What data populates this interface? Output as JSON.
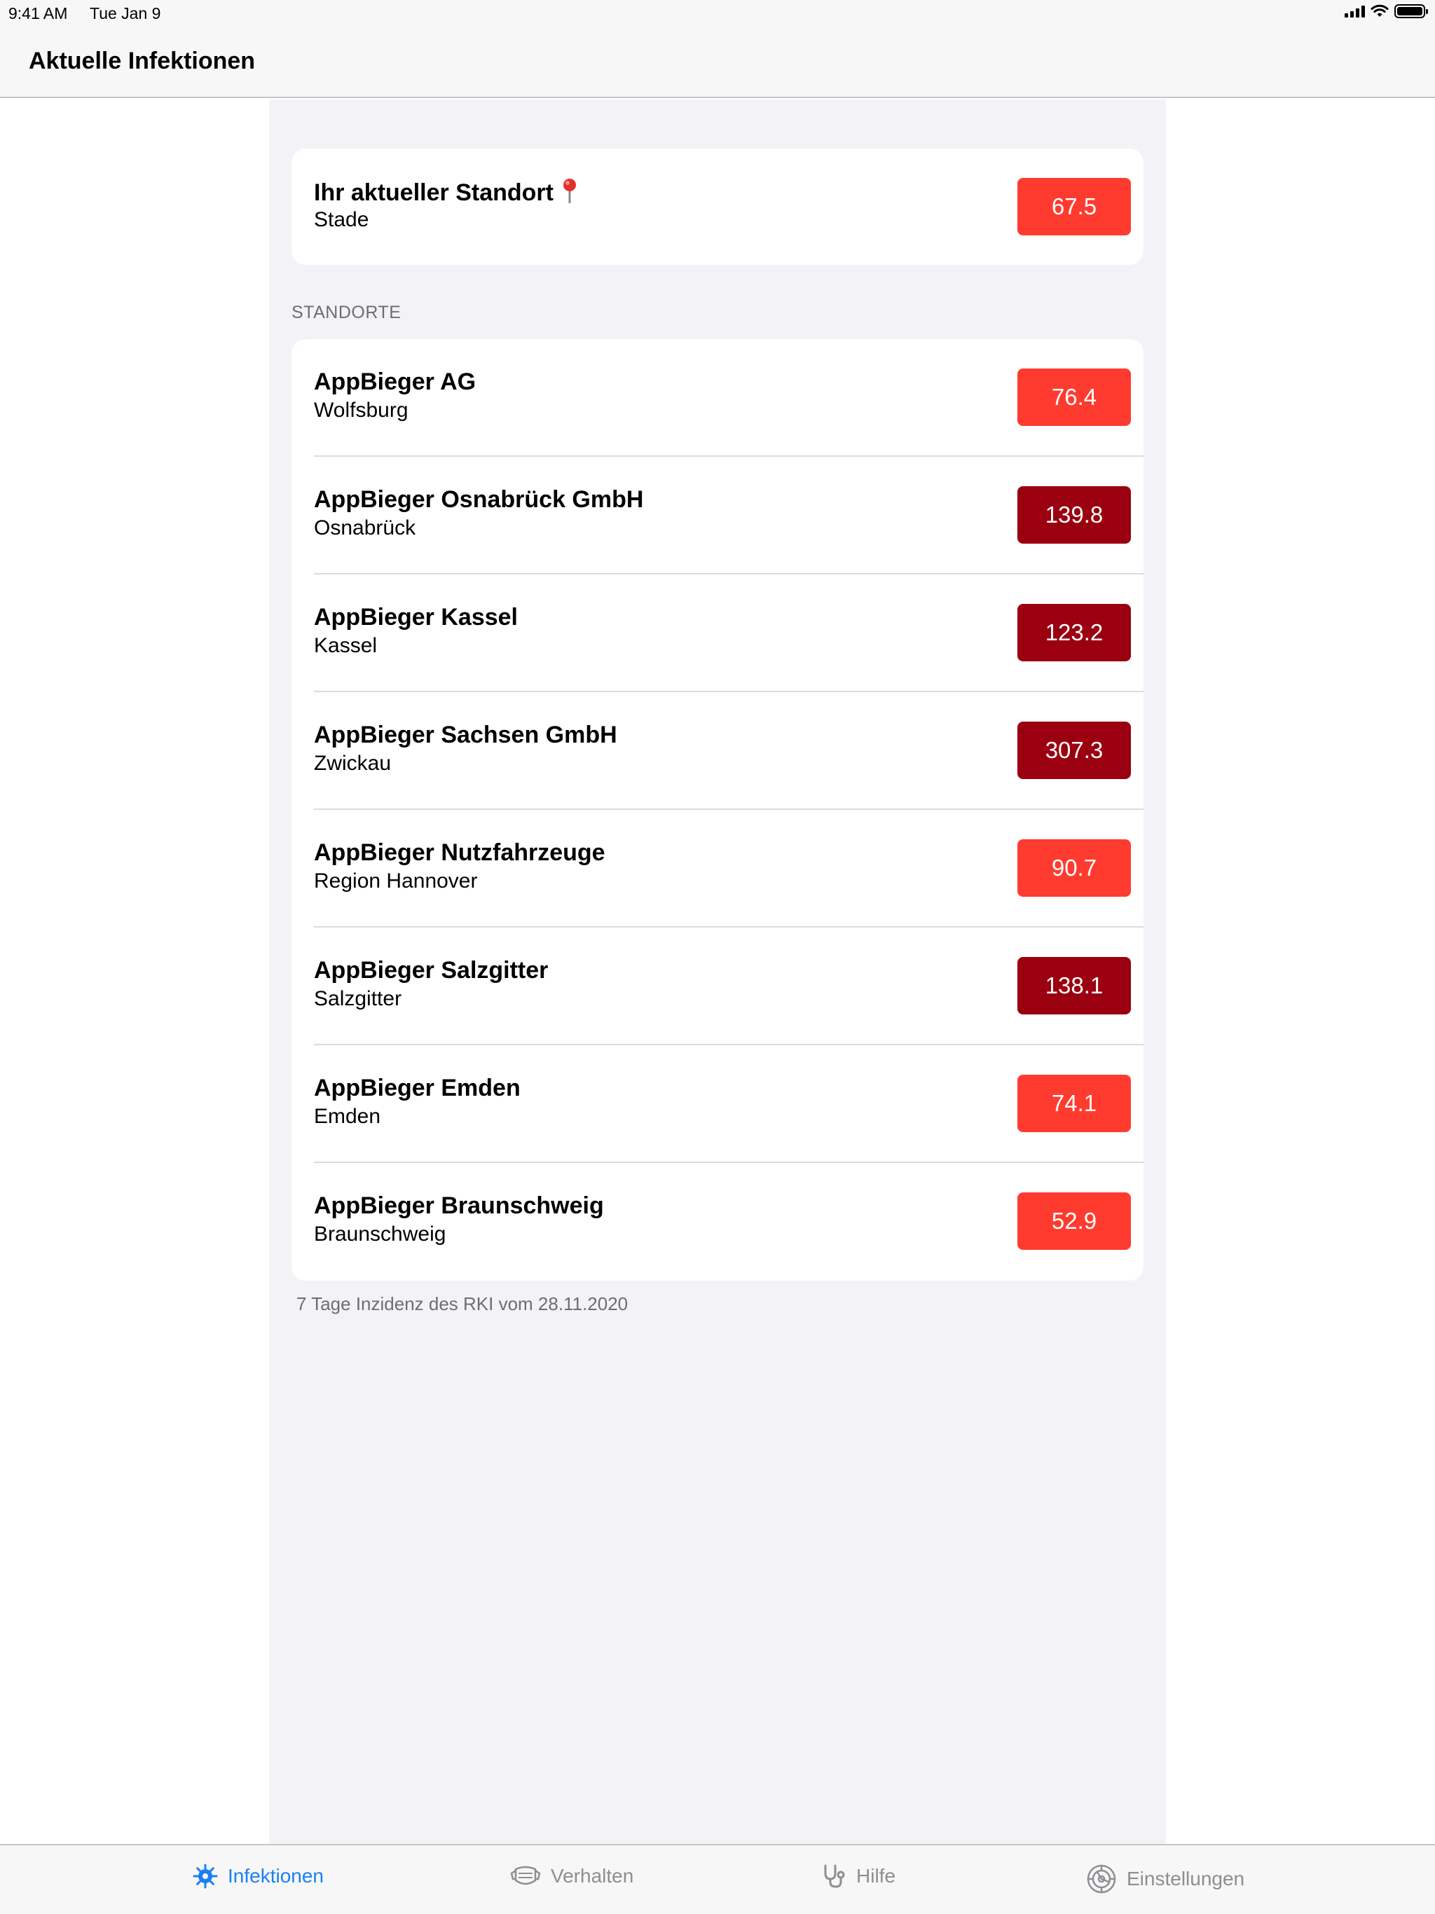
{
  "status_bar": {
    "time": "9:41 AM",
    "date": "Tue Jan 9"
  },
  "nav": {
    "title": "Aktuelle Infektionen"
  },
  "current_location": {
    "title": "Ihr aktueller Standort",
    "city": "Stade",
    "value": "67.5",
    "level": "high"
  },
  "section_header": "STANDORTE",
  "locations": [
    {
      "name": "AppBieger AG",
      "city": "Wolfsburg",
      "value": "76.4",
      "level": "high"
    },
    {
      "name": "AppBieger Osnabrück GmbH",
      "city": "Osnabrück",
      "value": "139.8",
      "level": "very-high"
    },
    {
      "name": "AppBieger Kassel",
      "city": "Kassel",
      "value": "123.2",
      "level": "very-high"
    },
    {
      "name": "AppBieger Sachsen GmbH",
      "city": "Zwickau",
      "value": "307.3",
      "level": "very-high"
    },
    {
      "name": "AppBieger Nutzfahrzeuge",
      "city": "Region Hannover",
      "value": "90.7",
      "level": "high"
    },
    {
      "name": "AppBieger Salzgitter",
      "city": "Salzgitter",
      "value": "138.1",
      "level": "very-high"
    },
    {
      "name": "AppBieger Emden",
      "city": "Emden",
      "value": "74.1",
      "level": "high"
    },
    {
      "name": "AppBieger Braunschweig",
      "city": "Braunschweig",
      "value": "52.9",
      "level": "high"
    }
  ],
  "footnote": "7 Tage Inzidenz des RKI vom 28.11.2020",
  "colors": {
    "high": "#ff3b30",
    "very-high": "#9b0010",
    "accent": "#1a7ff5"
  },
  "tabs": [
    {
      "label": "Infektionen",
      "icon": "virus-icon",
      "active": true
    },
    {
      "label": "Verhalten",
      "icon": "mask-icon",
      "active": false
    },
    {
      "label": "Hilfe",
      "icon": "stethoscope-icon",
      "active": false
    },
    {
      "label": "Einstellungen",
      "icon": "gear-icon",
      "active": false
    }
  ]
}
